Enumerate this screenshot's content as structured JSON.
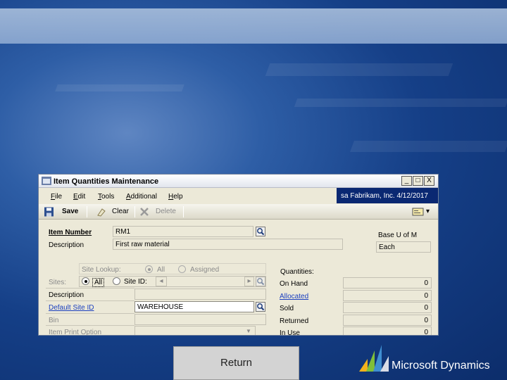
{
  "window": {
    "title": "Item Quantities Maintenance",
    "controls": {
      "minimize": "_",
      "maximize": "□",
      "close": "X"
    }
  },
  "menu": {
    "items": [
      "File",
      "Edit",
      "Tools",
      "Additional",
      "Help"
    ],
    "company_info": "sa  Fabrikam, Inc.  4/12/2017"
  },
  "toolbar": {
    "save_label": "Save",
    "clear_label": "Clear",
    "delete_label": "Delete",
    "dropdown_caret": "▾"
  },
  "form": {
    "item_number_label": "Item Number",
    "item_number_value": "RM1",
    "description_label": "Description",
    "description_value": "First raw material",
    "base_uom_label": "Base U of M",
    "base_uom_value": "Each",
    "site_lookup_label": "Site Lookup:",
    "site_lookup_all": "All",
    "site_lookup_assigned": "Assigned",
    "sites_label": "Sites:",
    "sites_all": "All",
    "sites_site_id": "Site ID:",
    "site_description_label": "Description",
    "default_site_label": "Default Site ID",
    "default_site_value": "WAREHOUSE",
    "bin_label": "Bin",
    "item_print_option_label": "Item Print Option",
    "quantities_label": "Quantities:"
  },
  "quantities": [
    {
      "label": "On Hand",
      "value": "0",
      "link": false
    },
    {
      "label": "Allocated",
      "value": "0",
      "link": true
    },
    {
      "label": "Sold",
      "value": "0",
      "link": false
    },
    {
      "label": "Returned",
      "value": "0",
      "link": false
    },
    {
      "label": "In Use",
      "value": "0",
      "link": false
    }
  ],
  "footer": {
    "return_label": "Return",
    "brand": "Microsoft Dynamics"
  },
  "colors": {
    "company_bg": "#0a2872",
    "link": "#1a3fbf",
    "background": "#153f87"
  },
  "icons": [
    "window-icon",
    "save-icon",
    "clear-icon",
    "delete-icon",
    "lookup-icon",
    "note-icon",
    "dynamics-logo"
  ]
}
